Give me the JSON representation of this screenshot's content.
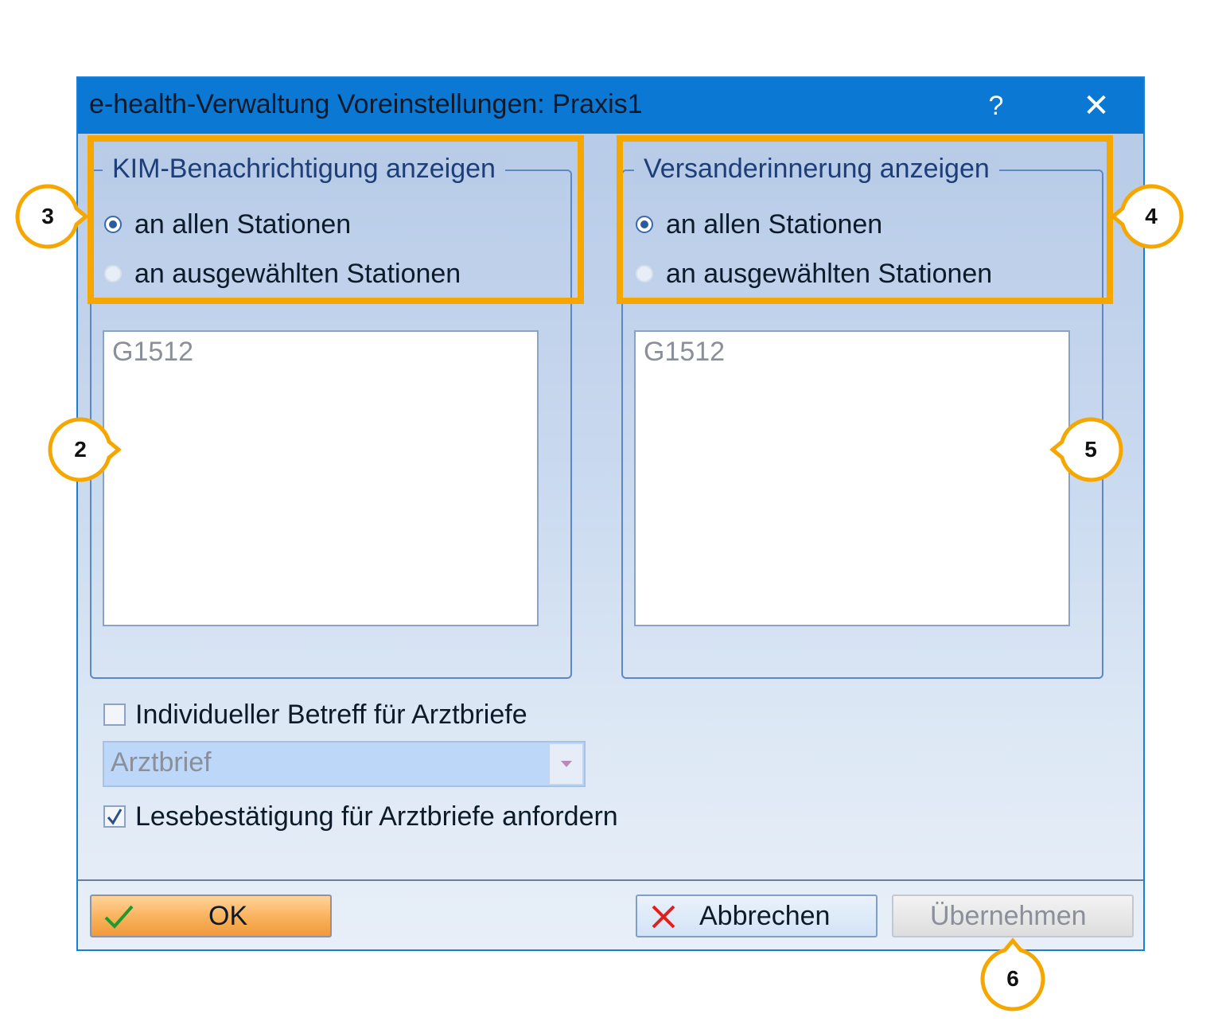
{
  "dialog": {
    "title": "e-health-Verwaltung Voreinstellungen: Praxis1",
    "help_label": "?",
    "close_label": "✕"
  },
  "kim_group": {
    "legend": "KIM-Benachrichtigung anzeigen",
    "options": [
      {
        "label": "an allen Stationen",
        "selected": true
      },
      {
        "label": "an ausgewählten Stationen",
        "selected": false
      }
    ],
    "list_items": [
      "G1512"
    ]
  },
  "reminder_group": {
    "legend": "Versanderinnerung anzeigen",
    "options": [
      {
        "label": "an allen Stationen",
        "selected": true
      },
      {
        "label": "an ausgewählten Stationen",
        "selected": false
      }
    ],
    "list_items": [
      "G1512"
    ]
  },
  "individual_subject": {
    "label": "Individueller Betreff für Arztbriefe",
    "checked": false,
    "combo_value": "Arztbrief"
  },
  "read_receipt": {
    "label": "Lesebestätigung für Arztbriefe anfordern",
    "checked": true
  },
  "buttons": {
    "ok": "OK",
    "cancel": "Abbrechen",
    "apply": "Übernehmen"
  },
  "callouts": [
    "2",
    "3",
    "4",
    "5",
    "6"
  ],
  "colors": {
    "titlebar": "#0b78d4",
    "highlight": "#f5a700",
    "ok_button": "#f9b15a",
    "cancel_icon": "#e0201b",
    "ok_icon": "#1f9a2e"
  },
  "icons": {
    "ok": "checkmark-icon",
    "cancel": "red-x-icon",
    "help": "question-mark-icon",
    "close": "close-icon"
  }
}
